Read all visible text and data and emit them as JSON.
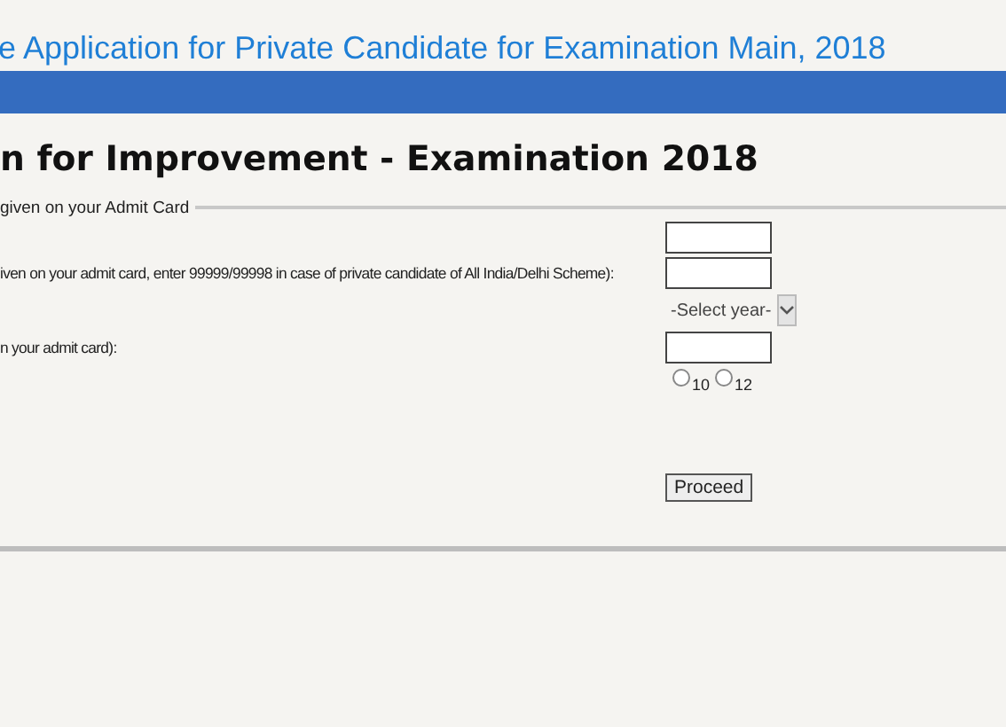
{
  "page_title": "e Application for Private Candidate for Examination Main, 2018",
  "heading": "n for Improvement - Examination 2018",
  "fieldset_legend": "given on your Admit Card",
  "rows": [
    {
      "kind": "text",
      "label": "",
      "value": ""
    },
    {
      "kind": "text",
      "label": "iven on your admit card, enter 99999/99998 in case of private candidate of All India/Delhi Scheme):",
      "value": ""
    },
    {
      "kind": "select",
      "label": "",
      "value": "-Select year-"
    },
    {
      "kind": "text",
      "label": "n your admit card):",
      "value": ""
    },
    {
      "kind": "radio",
      "label": "",
      "options": [
        {
          "label": "10",
          "selected": false
        },
        {
          "label": "12",
          "selected": false
        }
      ]
    },
    {
      "kind": "button",
      "label": "",
      "value": "Proceed"
    }
  ]
}
